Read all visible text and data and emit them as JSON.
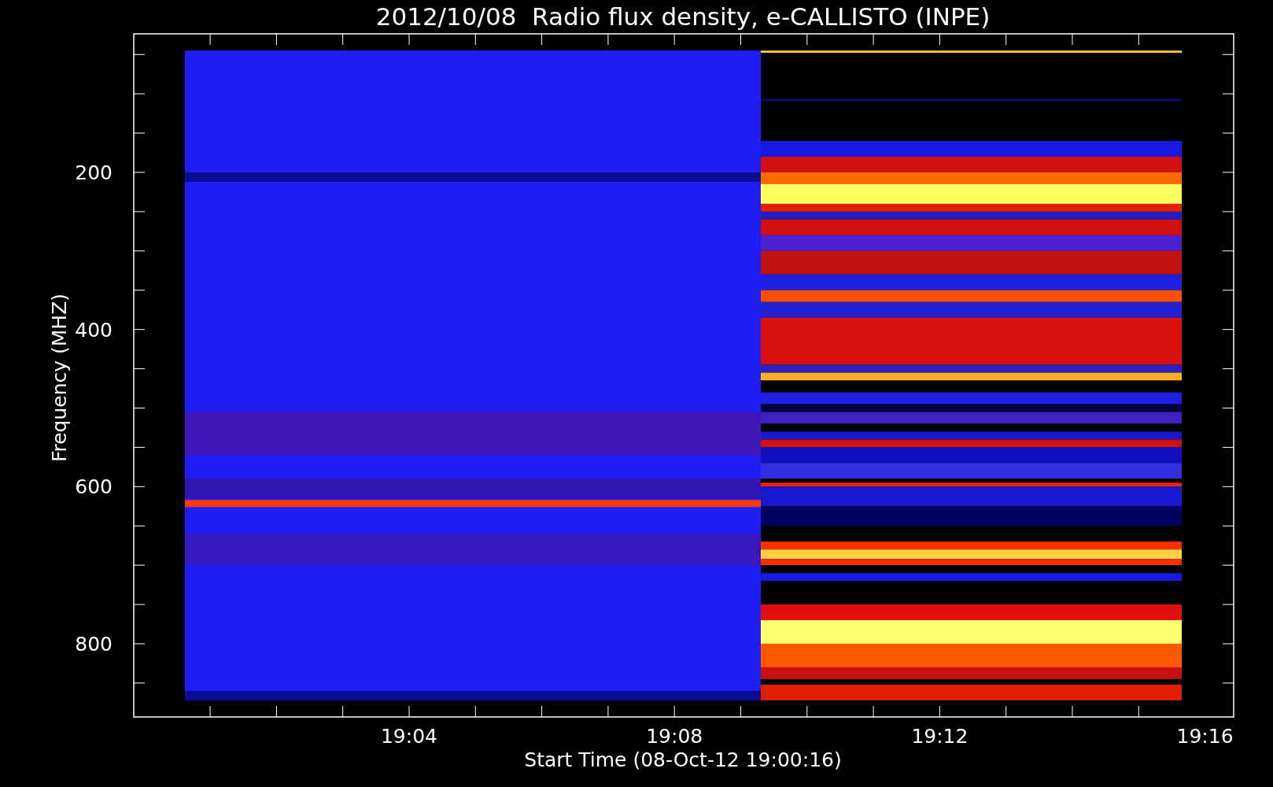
{
  "title": "2012/10/08  Radio flux density, e-CALLISTO (INPE)",
  "y_axis": {
    "label": "Frequency (MHZ)",
    "ticks": [
      "200",
      "400",
      "600",
      "800"
    ]
  },
  "x_axis": {
    "label": "Start Time (08-Oct-12 19:00:16)",
    "ticks": [
      "19:04",
      "19:08",
      "19:12",
      "19:16"
    ]
  }
}
